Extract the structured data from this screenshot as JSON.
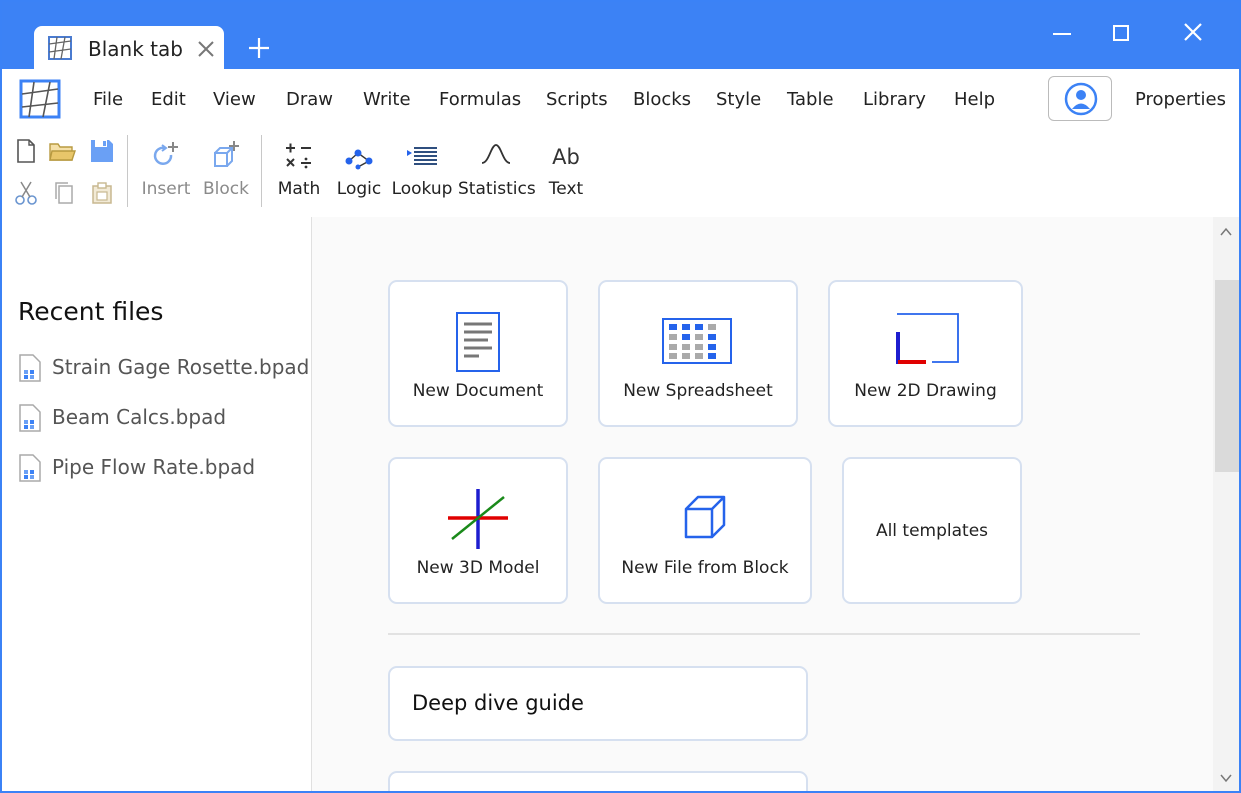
{
  "tab": {
    "title": "Blank tab"
  },
  "menu": {
    "items": [
      "File",
      "Edit",
      "View",
      "Draw",
      "Write",
      "Formulas",
      "Scripts",
      "Blocks",
      "Style",
      "Table",
      "Library",
      "Help"
    ],
    "properties_label": "Properties"
  },
  "toolbar": {
    "insert_label": "Insert",
    "block_label": "Block",
    "math_label": "Math",
    "logic_label": "Logic",
    "lookup_label": "Lookup",
    "statistics_label": "Statistics",
    "text_label": "Text",
    "text_icon_glyph": "Ab"
  },
  "sidebar": {
    "title": "Recent files",
    "files": [
      "Strain Gage Rosette.bpad",
      "Beam Calcs.bpad",
      "Pipe Flow Rate.bpad"
    ]
  },
  "templates": {
    "new_document": "New Document",
    "new_spreadsheet": "New Spreadsheet",
    "new_2d_drawing": "New 2D Drawing",
    "new_3d_model": "New 3D Model",
    "new_file_from_block": "New File from Block",
    "all_templates": "All templates"
  },
  "guides": {
    "deep_dive": "Deep dive guide"
  },
  "colors": {
    "titlebar": "#3c82f5",
    "accent": "#2563eb",
    "card_border": "#d6e0f0"
  }
}
